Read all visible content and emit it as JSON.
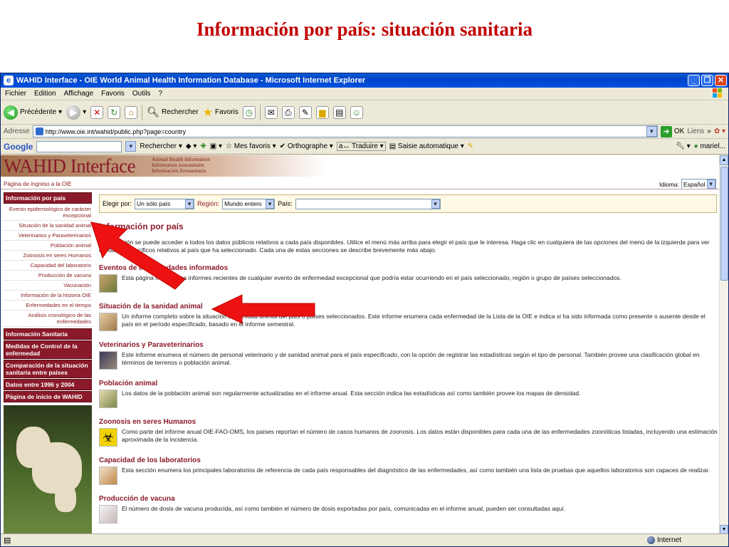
{
  "slide_title": "Información por país: situación sanitaria",
  "window": {
    "title": "WAHID Interface - OIE World Animal Health Information Database - Microsoft Internet Explorer"
  },
  "menu": [
    "Fichier",
    "Edition",
    "Affichage",
    "Favoris",
    "Outils",
    "?"
  ],
  "toolbar": {
    "back": "Précédente",
    "search": "Rechercher",
    "favorites": "Favoris"
  },
  "address": {
    "label": "Adresse",
    "url": "http://www.oie.int/wahid/public.php?page=country",
    "go": "OK",
    "links": "Liens"
  },
  "googlebar": {
    "logo": "Google",
    "search": "Rechercher",
    "favorites": "Mes favoris",
    "spell": "Orthographe",
    "translate": "Traduire",
    "autofill": "Saisie automatique",
    "user": "mariel..."
  },
  "page": {
    "logo": "WAHID Interface",
    "logo_sub": [
      "Animal Health Information",
      "Information zoosanitaire",
      "Información Zoosanitaria"
    ],
    "entry_link": "Página de ingreso a la OIE",
    "language_label": "Idioma:",
    "language_value": "Español",
    "filter": {
      "select_by_label": "Elegir por:",
      "select_by_value": "Un sólo país",
      "region_label": "Región:",
      "region_value": "Mundo entero",
      "country_label": "País:",
      "country_value": ""
    },
    "sidebar": {
      "country_head": "Información por país",
      "items": [
        "Evento epidemiológico de carácter excepcional",
        "Situación de la sanidad animal",
        "Veterinarios y Paraveterinarios",
        "Población animal",
        "Zoonosis en seres Humanos",
        "Capacidad del laboratorio",
        "Producción de vacuna",
        "Vacunación",
        "Información de la historia OIE",
        "Enfermedades en el tiempo",
        "Análisis cronológico de las enfermedades"
      ],
      "heads": [
        "Información Sanitaria",
        "Medidas de Control de la enfermedad",
        "Comparación de la situación sanitaria entre países",
        "Datos entre 1996 y 2004",
        "Página de inicio de WAHID"
      ]
    },
    "main_title": "Información por país",
    "intro": "Esta sección se puede acceder a todos los datos públicos relativos a cada país disponibles. Utilice el menú más arriba para elegir el país que le interesa. Haga clic en cualquiera de las opciones del menú de la izquierda para ver los datos específicos relativos al país que ha seleccionado. Cada una de estas secciones se describe brevemente más abajo.",
    "sections": [
      {
        "title": "Eventos de enfermedades informados",
        "desc": "Esta página muestra las informes recientes de cualquier evento de enfermedad excepcional que podría estar ocurriendo en el país seleccionado, región o grupo de países seleccionados."
      },
      {
        "title": "Situación de la sanidad animal",
        "desc": "Un informe completo sobre la situación de sanidad animal del país o países seleccionados. Este informe enumera cada enfermedad de la Lista de la OIE e indica si ha sido informada como presente o ausente desde el país en el período especificado, basado en el informe semestral."
      },
      {
        "title": "Veterinarios y Paraveterinarios",
        "desc": "Este informe enumera el número de personal veterinario y de sanidad animal para el país especificado, con la opción de registrar las estadísticas según el tipo de personal. También provee una clasificación global en términos de terrenos o población animal."
      },
      {
        "title": "Población animal",
        "desc": "Los datos de la población animal son regularmente actualizadas en el informe anual. Esta sección indica las estadísticas así como también provee los mapas de densidad."
      },
      {
        "title": "Zoonosis en seres Humanos",
        "desc": "Como parte del informe anual OIE-FAO-OMS, los países reportan el número de casos humanos de zoonosis. Los datos están disponibles para cada una de las enfermedades zoonóticas listadas, incluyendo una estimación aproximada de la incidencia."
      },
      {
        "title": "Capacidad de los laboratorios",
        "desc": "Esta sección enumera los principales laboratorios de referencia de cada país responsables del diagnóstico de las enfermedades, así como también una lista de pruebas que aquellos laboratorios son capaces de realizar."
      },
      {
        "title": "Producción de vacuna",
        "desc": "El número de dosis de vacuna producida, así como también el número de dosis exportadas por país, comunicadas en el informe anual, pueden ser consultadas aquí."
      }
    ]
  },
  "status": {
    "zone": "Internet"
  },
  "colors": {
    "slide_title": "#c00000",
    "brand": "#8a1a2a",
    "arrow": "#ee1111"
  }
}
